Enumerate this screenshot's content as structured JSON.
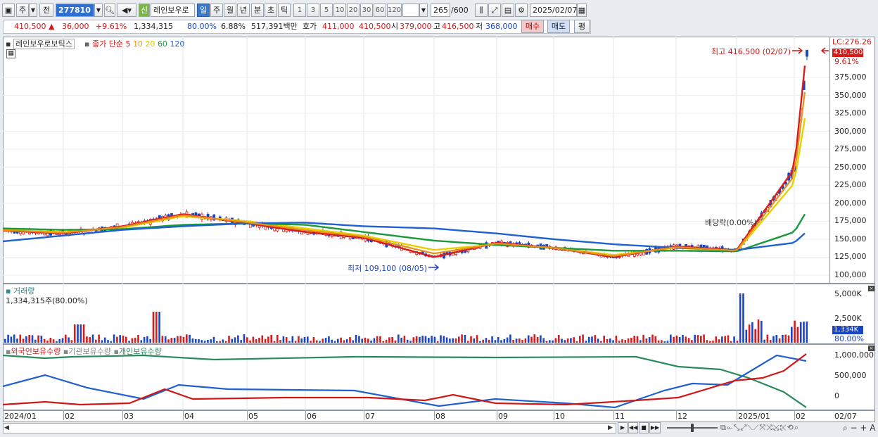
{
  "toolbar": {
    "market": "주",
    "prev": "전",
    "code": "277810",
    "badge_new": "신",
    "stock_name": "레인보우로",
    "periods": [
      "일",
      "주",
      "월",
      "년",
      "분",
      "초",
      "틱"
    ],
    "intervals": [
      "1",
      "3",
      "5",
      "10",
      "20",
      "30",
      "60",
      "120"
    ],
    "count": "265",
    "count_total": "/600",
    "date": "2025/02/07"
  },
  "info": {
    "price": "410,500 ▲",
    "change": "36,000",
    "change_pct": "+9.61%",
    "volume": "1,334,315",
    "vol_ratio": "80.00%",
    "turnover": "6.88%",
    "amount": "517,391백만",
    "quote_label": "호가",
    "bid": "411,000",
    "ask": "410,500",
    "open_label": "시",
    "open": "379,000",
    "high_label": "고",
    "high": "416,500",
    "low_label": "저",
    "low": "368,000",
    "buy_btn": "매수",
    "sell_btn": "매도",
    "eval_btn": "평"
  },
  "price_panel": {
    "title": "레인보우로보틱스",
    "ma_label": "종가 단순",
    "ma_periods": [
      "5",
      "10",
      "20",
      "60",
      "120"
    ],
    "ma_colors": [
      "#d81b1b",
      "#e8a000",
      "#d8d800",
      "#1a9a3a",
      "#2060d0"
    ],
    "lc_label": "LC:276.26",
    "current_tag": "410,500",
    "current_pct": "9.61%",
    "high_annot": "최고 416,500 (02/07)",
    "low_annot": "최저 109,100 (08/05)",
    "dividend_annot": "배당락(0.00%)",
    "y_ticks": [
      "375,000",
      "350,000",
      "325,000",
      "300,000",
      "275,000",
      "250,000",
      "225,000",
      "200,000",
      "175,000",
      "150,000",
      "125,000",
      "100,000"
    ]
  },
  "volume_panel": {
    "title": "거래량",
    "value": "1,334,315주(80.00%)",
    "y_ticks": [
      "5,000K",
      "2,500K"
    ],
    "current_tag": "1,334K",
    "current_pct": "80.00%"
  },
  "holding_panel": {
    "legend": [
      "외국인보유수량",
      "기관보유수량",
      "개인보유수량"
    ],
    "legend_colors": [
      "#d01818",
      "#888888",
      "#2a8a5a"
    ],
    "y_ticks": [
      "1,000,000",
      "500,000",
      "0"
    ]
  },
  "x_axis": {
    "labels": [
      "2024/01",
      "02",
      "03",
      "04",
      "05",
      "06",
      "07",
      "08",
      "09",
      "10",
      "11",
      "12",
      "2025/01",
      "02"
    ],
    "right_label": "02/07"
  },
  "chart_data": {
    "type": "line",
    "title": "레인보우로보틱스",
    "xlabel": "",
    "ylabel": "",
    "ylim": [
      100000,
      420000
    ],
    "x": [
      "2024/01",
      "02",
      "03",
      "04",
      "05",
      "06",
      "07",
      "08",
      "09",
      "10",
      "11",
      "12",
      "2025/01",
      "02",
      "02/07"
    ],
    "series": [
      {
        "name": "5",
        "values": [
          162000,
          158000,
          168000,
          185000,
          172000,
          160000,
          152000,
          125000,
          145000,
          138000,
          125000,
          140000,
          135000,
          248000,
          410500
        ]
      },
      {
        "name": "20",
        "values": [
          163000,
          160000,
          166000,
          182000,
          175000,
          165000,
          155000,
          135000,
          143000,
          138000,
          128000,
          138000,
          133000,
          228000,
          330000
        ]
      },
      {
        "name": "60",
        "values": [
          165000,
          163000,
          164000,
          170000,
          172000,
          170000,
          160000,
          148000,
          142000,
          138000,
          134000,
          134000,
          133000,
          160000,
          188000
        ]
      },
      {
        "name": "120",
        "values": [
          147000,
          155000,
          163000,
          168000,
          172000,
          173000,
          168000,
          165000,
          158000,
          150000,
          143000,
          138000,
          135000,
          145000,
          160000
        ]
      }
    ],
    "grid": true,
    "legend": "top-left"
  }
}
